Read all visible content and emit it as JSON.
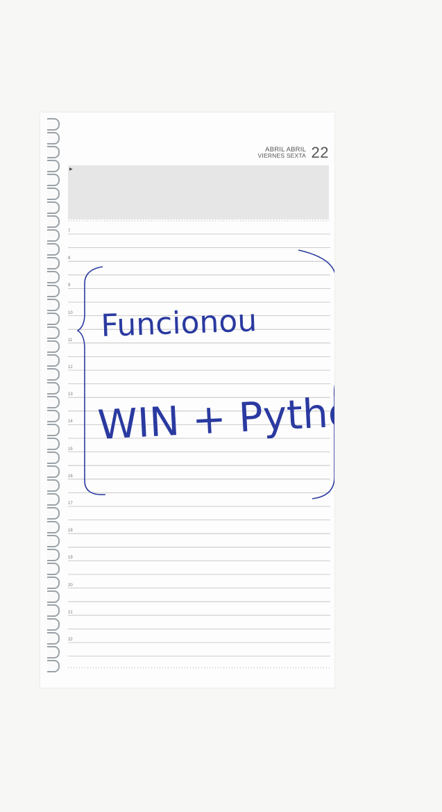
{
  "header": {
    "month_es": "ABRIL",
    "month_pt": "ABRIL",
    "weekday_es": "VIERNES",
    "weekday_pt": "SEXTA",
    "day_number": "22"
  },
  "hours": [
    "7",
    "8",
    "9",
    "10",
    "11",
    "12",
    "13",
    "14",
    "15",
    "16",
    "17",
    "18",
    "19",
    "20",
    "21",
    "22"
  ],
  "handwriting": {
    "line1": "Funcionou",
    "line2": "WIN + Python"
  }
}
